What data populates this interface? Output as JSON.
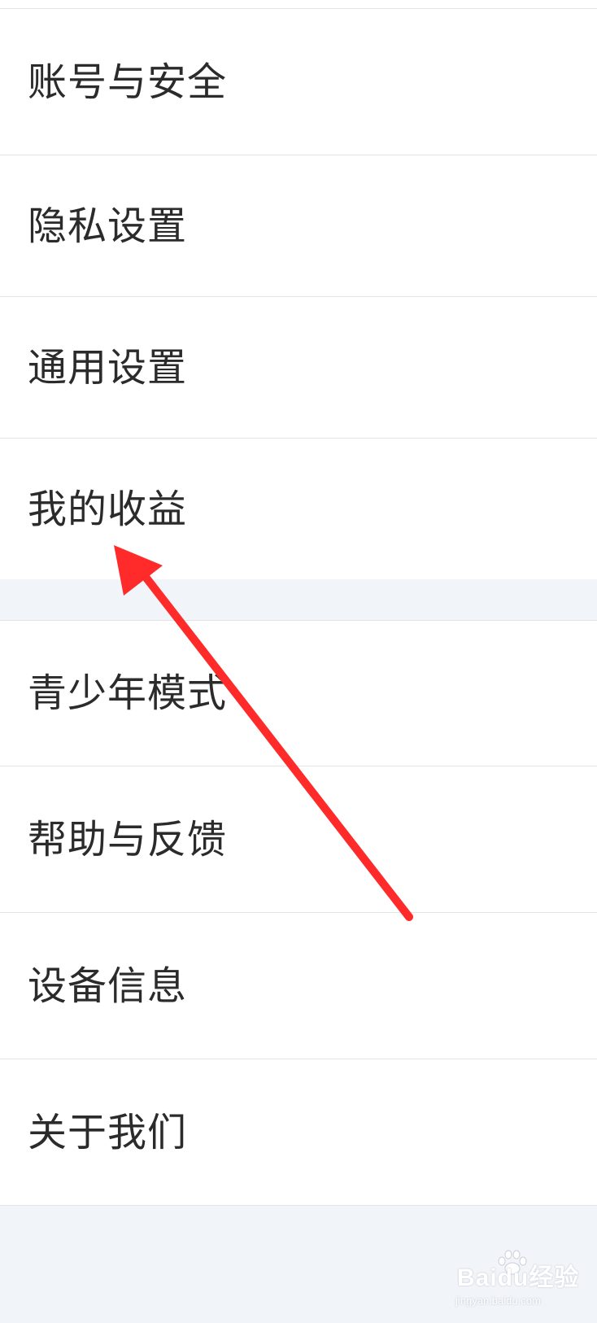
{
  "settings": {
    "group_1": [
      {
        "label": "账号与安全"
      },
      {
        "label": "隐私设置"
      },
      {
        "label": "通用设置"
      },
      {
        "label": "我的收益"
      }
    ],
    "group_2": [
      {
        "label": "青少年模式"
      },
      {
        "label": "帮助与反馈"
      },
      {
        "label": "设备信息"
      },
      {
        "label": "关于我们"
      }
    ]
  },
  "annotation": {
    "type": "arrow-icon",
    "color": "#ff2a2a",
    "points_to": "我的收益"
  },
  "watermark": {
    "main": "Baidu经验",
    "sub": "jingyan.baidu.com",
    "icon": "paw-icon"
  },
  "colors": {
    "background": "#f1f4f8",
    "item_background": "#ffffff",
    "text": "#2b2b2b",
    "divider": "#e4e4e4"
  }
}
